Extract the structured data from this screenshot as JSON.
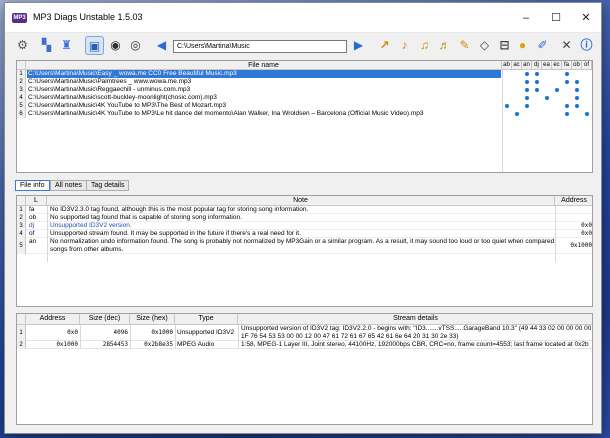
{
  "window": {
    "title": "MP3 Diags Unstable 1.5.03",
    "icon_text": "MP3"
  },
  "controls": {
    "minimize": "–",
    "maximize": "☐",
    "close": "✕"
  },
  "toolbar": {
    "path": "C:\\Users\\Martina\\Music"
  },
  "files": {
    "header": "File name",
    "note_columns": [
      "ab",
      "ac",
      "an",
      "dj",
      "ea",
      "ec",
      "fa",
      "ob",
      "of"
    ],
    "rows": [
      {
        "num": "1",
        "name": "C:\\Users\\Martina\\Music\\Easy _ wowa.me CC0 Free Beautiful Music.mp3",
        "notes": [
          0,
          0,
          1,
          1,
          0,
          0,
          1,
          0,
          0
        ]
      },
      {
        "num": "2",
        "name": "C:\\Users\\Martina\\Music\\Palmtrees _ www.wowa.me.mp3",
        "notes": [
          0,
          0,
          1,
          1,
          0,
          0,
          1,
          1,
          0
        ]
      },
      {
        "num": "3",
        "name": "C:\\Users\\Martina\\Music\\Reggaechill - unminus.com.mp3",
        "notes": [
          0,
          0,
          1,
          1,
          0,
          1,
          0,
          1,
          0
        ]
      },
      {
        "num": "4",
        "name": "C:\\Users\\Martina\\Music\\scott-buckley-moonlight(chosic.com).mp3",
        "notes": [
          0,
          0,
          1,
          0,
          1,
          0,
          0,
          1,
          0
        ]
      },
      {
        "num": "5",
        "name": "C:\\Users\\Martina\\Music\\4K YouTube to MP3\\The Best of Mozart.mp3",
        "notes": [
          1,
          0,
          1,
          0,
          0,
          0,
          1,
          1,
          0
        ]
      },
      {
        "num": "6",
        "name": "C:\\Users\\Martina\\Music\\4K YouTube to MP3\\Le hit dance del momento\\Alan Walker, Ina Wroldsen – Barcelona (Official Music Video).mp3",
        "notes": [
          0,
          1,
          0,
          0,
          0,
          0,
          1,
          0,
          1
        ]
      }
    ]
  },
  "tabs": [
    "File info",
    "All notes",
    "Tag details"
  ],
  "notes": {
    "headers": {
      "label": "L",
      "note": "Note",
      "address": "Address"
    },
    "rows": [
      {
        "num": "1",
        "label": "fa",
        "note": "No ID3V2.3.0 tag found, although this is the most popular tag for storing song information.",
        "address": "",
        "blue": false
      },
      {
        "num": "2",
        "label": "ob",
        "note": "No supported tag found that is capable of storing song information.",
        "address": "",
        "blue": false
      },
      {
        "num": "3",
        "label": "dj",
        "note": "Unsupported ID3V2 version.",
        "address": "0x0",
        "blue": true
      },
      {
        "num": "4",
        "label": "of",
        "note": "Unsupported stream found. It may be supported in the future if there's a real need for it.",
        "address": "0x0",
        "blue": false
      },
      {
        "num": "5",
        "label": "an",
        "note": "No normalization undo information found. The song is probably not normalized by MP3Gain or a similar program. As a result, it may sound too loud or too quiet when compared to",
        "note2": "songs from other albums.",
        "address": "0x1000",
        "blue": false
      }
    ]
  },
  "streams": {
    "headers": {
      "address": "Address",
      "size_dec": "Size (dec)",
      "size_hex": "Size (hex)",
      "type": "Type",
      "details": "Stream details"
    },
    "rows": [
      {
        "num": "1",
        "address": "0x0",
        "size_dec": "4096",
        "size_hex": "0x1000",
        "type": "Unsupported ID3V2",
        "details": "Unsupported version of ID3V2 tag: ID3V2.2.0 - begins with: \"ID3.......vTSS.....GarageBand 10.3\" (49 44 33 02 00 00 00 00",
        "details2": "1F 76 54 53 53 00 00 12 00 47 61 72 61 67 65 42 61 6e 64 20 31 30 2e 33)"
      },
      {
        "num": "2",
        "address": "0x1000",
        "size_dec": "2854453",
        "size_hex": "0x2b8e35",
        "type": "MPEG Audio",
        "details": "1:58, MPEG-1 Layer III, Joint stereo, 44100Hz, 192000bps CBR, CRC=no, frame count=4553; last frame located at 0x2b"
      }
    ]
  },
  "colors": {
    "selected_row": "#3078d8",
    "dot": "#1c6fd8",
    "blue_text": "#1c4fb8"
  }
}
